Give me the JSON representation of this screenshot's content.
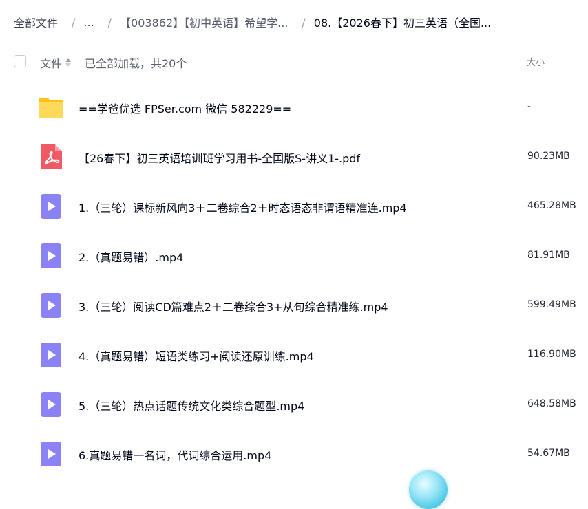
{
  "breadcrumb": {
    "items": [
      {
        "label": "全部文件"
      },
      {
        "label": "..."
      },
      {
        "label": "【003862】【初中英语】希望学..."
      },
      {
        "label": "08.【2026春下】初三英语（全国..."
      }
    ]
  },
  "header": {
    "name_label": "文件",
    "status_label": "已全部加载，共20个",
    "size_label": "大小"
  },
  "files": [
    {
      "name": "==学爸优选 FPSer.com 微信 582229==",
      "size": "-",
      "type": "folder"
    },
    {
      "name": "【26春下】初三英语培训班学习用书-全国版S-讲义1-.pdf",
      "size": "90.23MB",
      "type": "pdf"
    },
    {
      "name": "1.（三轮）课标新风向3＋二卷综合2＋时态语态非谓语精准连.mp4",
      "size": "465.28MB",
      "type": "video"
    },
    {
      "name": "2.（真题易错）.mp4",
      "size": "81.91MB",
      "type": "video"
    },
    {
      "name": "3.（三轮）阅读CD篇难点2＋二卷综合3+从句综合精准练.mp4",
      "size": "599.49MB",
      "type": "video"
    },
    {
      "name": "4.（真题易错）短语类练习+阅读还原训练.mp4",
      "size": "116.90MB",
      "type": "video"
    },
    {
      "name": "5.（三轮）热点话题传统文化类综合题型.mp4",
      "size": "648.58MB",
      "type": "video"
    },
    {
      "name": "6.真题易错一名词，代词综合运用.mp4",
      "size": "54.67MB",
      "type": "video"
    }
  ],
  "colors": {
    "folder": "#ffd24d",
    "pdf": "#f05a64",
    "video": "#8a82f5"
  }
}
